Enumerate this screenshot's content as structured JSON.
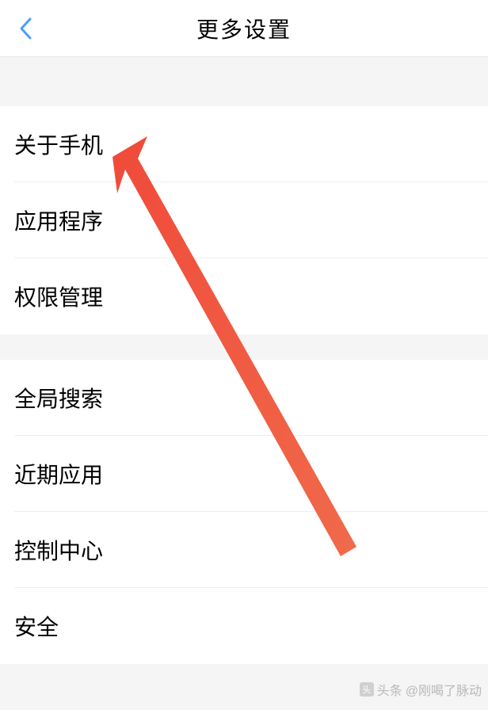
{
  "header": {
    "title": "更多设置"
  },
  "groups": [
    {
      "items": [
        {
          "label": "关于手机"
        },
        {
          "label": "应用程序"
        },
        {
          "label": "权限管理"
        }
      ]
    },
    {
      "items": [
        {
          "label": "全局搜索"
        },
        {
          "label": "近期应用"
        },
        {
          "label": "控制中心"
        },
        {
          "label": "安全"
        }
      ]
    }
  ],
  "watermark": {
    "prefix": "头条",
    "handle": "@刚喝了脉动"
  }
}
